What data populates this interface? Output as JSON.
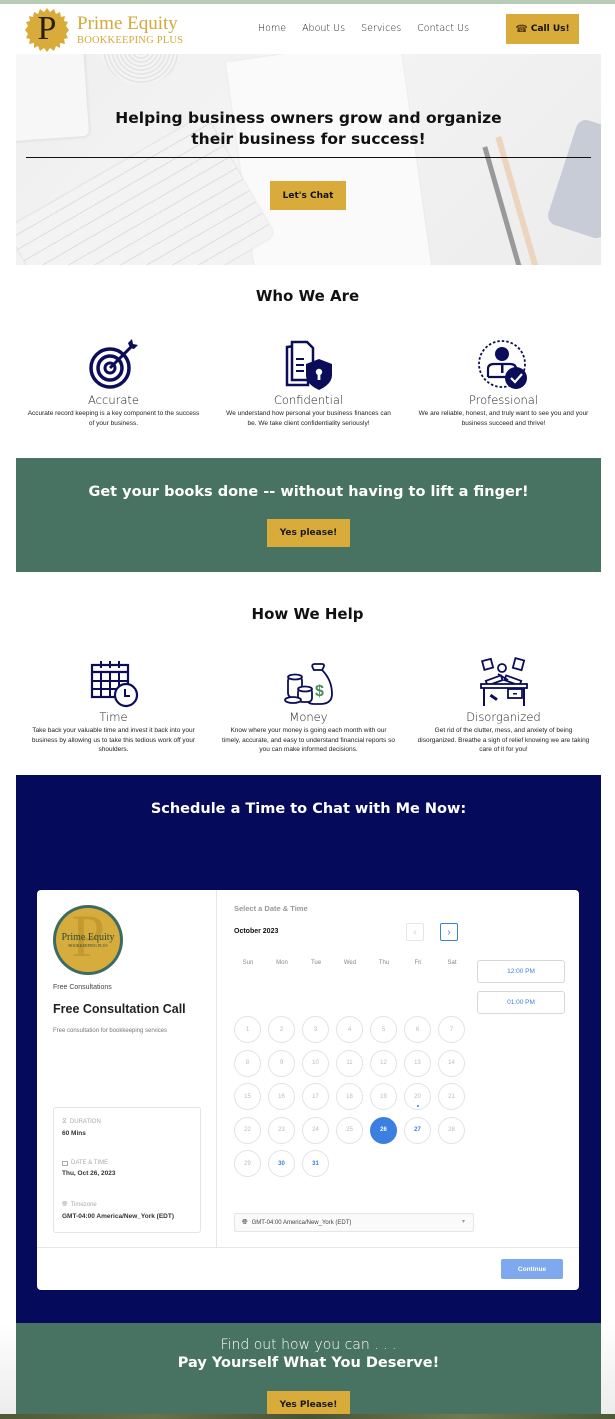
{
  "header": {
    "logo_letter": "P",
    "logo_title": "Prime Equity",
    "logo_subtitle": "BOOKKEEPING PLUS",
    "nav": [
      "Home",
      "About Us",
      "Services",
      "Contact Us"
    ],
    "call_button": "Call Us!",
    "call_icon": "phone-icon"
  },
  "hero": {
    "title_line1": "Helping business owners grow and organize",
    "title_line2": "their business for success!",
    "cta": "Let's Chat"
  },
  "who_we_are": {
    "title": "Who We Are",
    "items": [
      {
        "icon": "target-icon",
        "title": "Accurate",
        "desc": "Accurate record keeping is a key component to the success of your business."
      },
      {
        "icon": "secure-document-icon",
        "title": "Confidential",
        "desc": "We understand how personal your business finances can be. We take client confidentiality seriously!"
      },
      {
        "icon": "verified-professional-icon",
        "title": "Professional",
        "desc": "We are reliable, honest, and truly want to see you and your business succeed and thrive!"
      }
    ]
  },
  "band1": {
    "title": "Get your books done -- without having to lift a finger!",
    "cta": "Yes please!"
  },
  "how_we_help": {
    "title": "How We Help",
    "items": [
      {
        "icon": "calendar-clock-icon",
        "title": "Time",
        "desc": "Take back your valuable time and invest it back into your business by allowing us to take this tedious work off your shoulders."
      },
      {
        "icon": "money-bag-icon",
        "title": "Money",
        "desc": "Know where your money is going each month with our timely, accurate, and easy to understand financial reports so you can make informed decisions."
      },
      {
        "icon": "messy-desk-icon",
        "title": "Disorganized",
        "desc": "Get rid of the clutter, mess, and anxiety of being disorganized. Breathe a sigh of relief knowing we are taking care of it for you!"
      }
    ]
  },
  "schedule": {
    "title": "Schedule a Time to Chat with Me Now:",
    "widget": {
      "logo_title": "Prime Equity",
      "logo_subtitle": "BOOKKEEPING PLUS",
      "category": "Free Consultations",
      "event_title": "Free Consultation Call",
      "event_desc": "Free consultation for bookkeeping services",
      "duration_label": "DURATION",
      "duration_value": "60 Mins",
      "datetime_label": "DATE & TIME",
      "datetime_value": "Thu, Oct 26, 2023",
      "timezone_label": "Timezone",
      "timezone_value": "GMT-04:00 America/New_York (EDT)",
      "heading": "Select a Date & Time",
      "month": "October 2023",
      "prev_icon": "‹",
      "next_icon": "›",
      "weekdays": [
        "Sun",
        "Mon",
        "Tue",
        "Wed",
        "Thu",
        "Fri",
        "Sat"
      ],
      "days_in_month": 31,
      "first_weekday_index": 0,
      "selected_day": 26,
      "today_day": 20,
      "available_days": [
        26,
        27,
        30,
        31
      ],
      "time_slots": [
        "12:00 PM",
        "01:00 PM"
      ],
      "timezone_select": "GMT-04:00 America/New_York (EDT)",
      "continue": "Continue"
    }
  },
  "band2": {
    "subtitle": "Find out how you can . . .",
    "title": "Pay Yourself What You Deserve!",
    "cta": "Yes Please!"
  }
}
